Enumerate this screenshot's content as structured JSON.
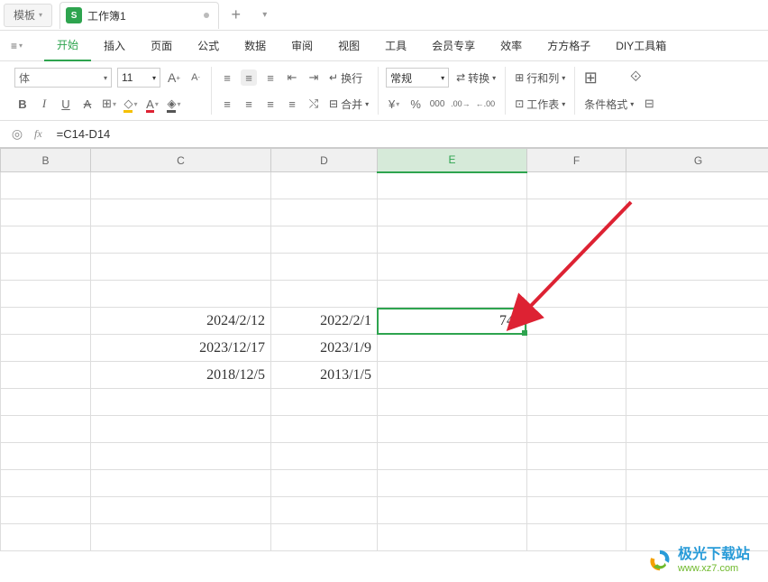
{
  "titlebar": {
    "template_label": "模板",
    "tab_label": "工作簿1",
    "new_tab_label": "+"
  },
  "menubar": {
    "items": [
      "开始",
      "插入",
      "页面",
      "公式",
      "数据",
      "审阅",
      "视图",
      "工具",
      "会员专享",
      "效率",
      "方方格子",
      "DIY工具箱"
    ],
    "active_index": 0
  },
  "toolbar": {
    "font_name": "体",
    "font_size": "11",
    "wrap_label": "换行",
    "merge_label": "合并",
    "number_format": "常规",
    "convert_label": "转换",
    "rowcol_label": "行和列",
    "worksheet_label": "工作表",
    "cond_fmt_label": "条件格式"
  },
  "formula_bar": {
    "fx_label": "fx",
    "formula": "=C14-D14"
  },
  "columns": [
    "B",
    "C",
    "D",
    "E",
    "F",
    "G"
  ],
  "active_col_index": 3,
  "cells": {
    "r14": {
      "c": "2024/2/12",
      "d": "2022/2/1",
      "e": "741"
    },
    "r15": {
      "c": "2023/12/17",
      "d": "2023/1/9"
    },
    "r16": {
      "c": "2018/12/5",
      "d": "2013/1/5"
    }
  },
  "watermark": {
    "line1": "极光下载站",
    "line2": "www.xz7.com"
  }
}
